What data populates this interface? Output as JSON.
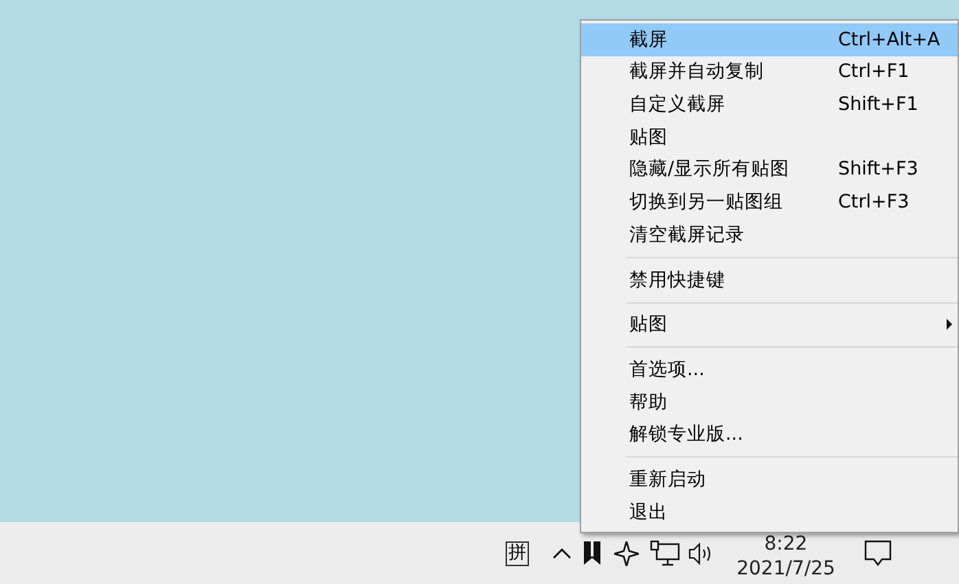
{
  "taskbar": {
    "ime": "拼",
    "time": "8:22",
    "date": "2021/7/25"
  },
  "menu": {
    "groups": [
      {
        "items": [
          {
            "kind": "item",
            "label": "截屏",
            "shortcut": "Ctrl+Alt+A",
            "selected": true
          },
          {
            "kind": "item",
            "label": "截屏并自动复制",
            "shortcut": "Ctrl+F1",
            "selected": false
          },
          {
            "kind": "item",
            "label": "自定义截屏",
            "shortcut": "Shift+F1",
            "selected": false
          },
          {
            "kind": "item",
            "label": "贴图",
            "selected": false
          },
          {
            "kind": "item",
            "label": "隐藏/显示所有贴图",
            "shortcut": "Shift+F3",
            "selected": false
          },
          {
            "kind": "item",
            "label": "切换到另一贴图组",
            "shortcut": "Ctrl+F3",
            "selected": false
          },
          {
            "kind": "item",
            "label": "清空截屏记录",
            "selected": false
          }
        ]
      },
      {
        "items": [
          {
            "kind": "item",
            "label": "禁用快捷键",
            "selected": false
          }
        ]
      },
      {
        "items": [
          {
            "kind": "submenu",
            "label": "贴图",
            "selected": false
          }
        ]
      },
      {
        "items": [
          {
            "kind": "item",
            "label": "首选项...",
            "selected": false
          },
          {
            "kind": "item",
            "label": "帮助",
            "selected": false
          },
          {
            "kind": "item",
            "label": "解锁专业版...",
            "selected": false
          }
        ]
      },
      {
        "items": [
          {
            "kind": "item",
            "label": "重新启动",
            "selected": false
          },
          {
            "kind": "item",
            "label": "退出",
            "selected": false
          }
        ]
      }
    ]
  }
}
